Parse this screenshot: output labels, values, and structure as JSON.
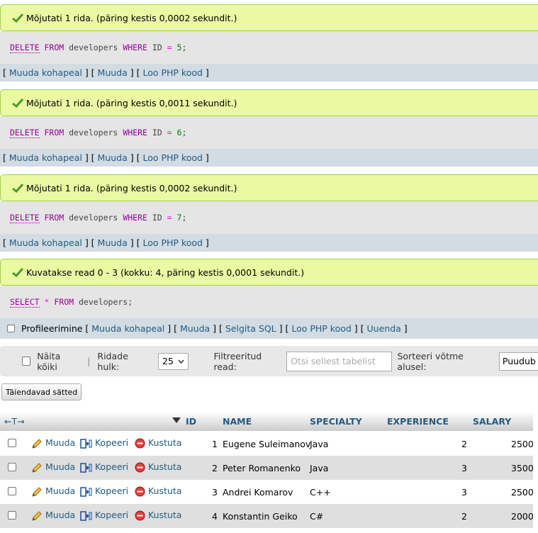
{
  "messages": [
    {
      "text": "Mõjutati 1 rida. (päring kestis 0,0002 sekundit.)",
      "sql_keywords": [
        "DELETE",
        "FROM",
        "WHERE"
      ],
      "sql_table": "developers",
      "sql_field": "ID",
      "sql_op": "=",
      "sql_value": "5",
      "sql_end": ";",
      "links": [
        "Muuda kohapeal",
        "Muuda",
        "Loo PHP kood"
      ]
    },
    {
      "text": "Mõjutati 1 rida. (päring kestis 0,0011 sekundit.)",
      "sql_keywords": [
        "DELETE",
        "FROM",
        "WHERE"
      ],
      "sql_table": "developers",
      "sql_field": "ID",
      "sql_op": "=",
      "sql_value": "6",
      "sql_end": ";",
      "links": [
        "Muuda kohapeal",
        "Muuda",
        "Loo PHP kood"
      ]
    },
    {
      "text": "Mõjutati 1 rida. (päring kestis 0,0002 sekundit.)",
      "sql_keywords": [
        "DELETE",
        "FROM",
        "WHERE"
      ],
      "sql_table": "developers",
      "sql_field": "ID",
      "sql_op": "=",
      "sql_value": "7",
      "sql_end": ";",
      "links": [
        "Muuda kohapeal",
        "Muuda",
        "Loo PHP kood"
      ]
    }
  ],
  "select_message": {
    "text": "Kuvatakse read 0 - 3 (kokku: 4, päring kestis 0,0001 sekundit.)",
    "sql_select": "SELECT",
    "sql_star": "*",
    "sql_from": "FROM",
    "sql_table": "developers;",
    "profiling_label": "Profileerimine",
    "links": [
      "Muuda kohapeal",
      "Muuda",
      "Selgita SQL",
      "Loo PHP kood",
      "Uuenda"
    ]
  },
  "navigation": {
    "show_all_label": "Näita kõiki",
    "rows_label": "Ridade hulk:",
    "rows_value": "25",
    "filter_label": "Filtreeritud read:",
    "filter_placeholder": "Otsi sellest tabelist",
    "sort_label": "Sorteeri võtme alusel:",
    "sort_value": "Puudub"
  },
  "options_button": "Täiendavad sätted",
  "table": {
    "arrows": "←T→",
    "columns": [
      "ID",
      "NAME",
      "SPECIALTY",
      "EXPERIENCE",
      "SALARY"
    ],
    "action_labels": {
      "edit": "Muuda",
      "copy": "Kopeeri",
      "delete": "Kustuta"
    },
    "rows": [
      {
        "id": "1",
        "name": "Eugene Suleimanov",
        "specialty": "Java",
        "experience": "2",
        "salary": "2500"
      },
      {
        "id": "2",
        "name": "Peter Romanenko",
        "specialty": "Java",
        "experience": "3",
        "salary": "3500"
      },
      {
        "id": "3",
        "name": "Andrei Komarov",
        "specialty": "C++",
        "experience": "3",
        "salary": "2500"
      },
      {
        "id": "4",
        "name": "Konstantin Geiko",
        "specialty": "C#",
        "experience": "2",
        "salary": "2000"
      }
    ]
  },
  "colors": {
    "success_bg": "#ebf8a4",
    "sql_bg": "#e5e5e5",
    "links_bg": "#d3dce3",
    "link": "#235a81",
    "keyword": "#990099"
  }
}
